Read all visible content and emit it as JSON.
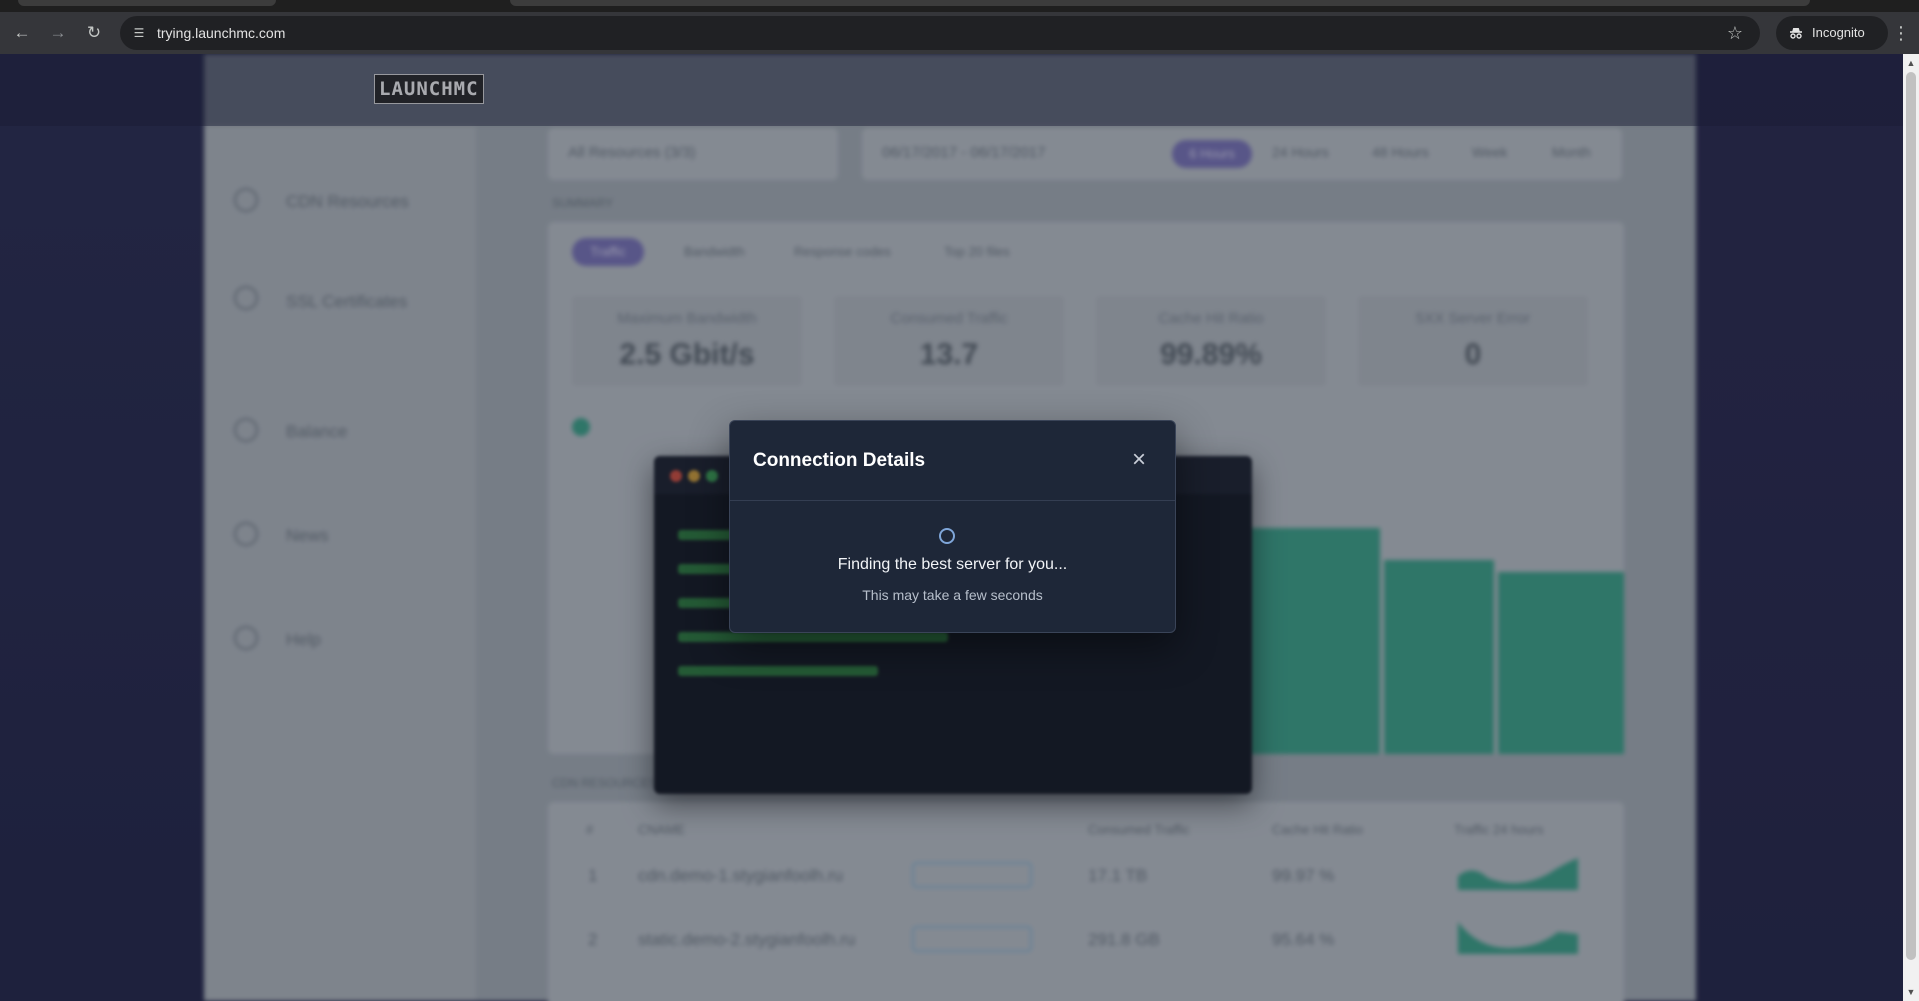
{
  "browser": {
    "url": "trying.launchmc.com",
    "incognito_label": "Incognito",
    "icons": [
      "back-icon",
      "forward-icon",
      "reload-icon",
      "site-info-icon",
      "bookmark-star-icon",
      "incognito-icon",
      "more-vert-icon"
    ]
  },
  "site": {
    "logo": "LAUNCHMC"
  },
  "background_dashboard": {
    "sidebar_items": [
      "CDN Resources",
      "SSL Certificates",
      "Balance",
      "News",
      "Help"
    ],
    "filters": {
      "resource_select": "All Resources (3/3)",
      "date_range": "06/17/2017 - 06/17/2017",
      "ranges": [
        "6 Hours",
        "24 Hours",
        "48 Hours",
        "Week",
        "Month"
      ]
    },
    "section_label": "SUMMARY",
    "tabs": [
      "Traffic",
      "Bandwidth",
      "Response codes",
      "Top 20 files"
    ],
    "stats": [
      {
        "title": "Maximum Bandwidth",
        "value": "2.5 Gbit/s"
      },
      {
        "title": "Consumed Traffic",
        "value": "13.7"
      },
      {
        "title": "Cache Hit Ratio",
        "value": "99.89%"
      },
      {
        "title": "5XX Server Error",
        "value": "0"
      }
    ],
    "table_label": "CDN RESOURCES",
    "table_headers": [
      "#",
      "CNAME",
      "Consumed Traffic",
      "Cache Hit Ratio",
      "Traffic 24 hours"
    ],
    "rows": [
      {
        "n": "1",
        "cname": "cdn.demo-1.stygianfoolh.ru",
        "traffic": "17.1 TB",
        "ratio": "99.97 %"
      },
      {
        "n": "2",
        "cname": "static.demo-2.stygianfoolh.ru",
        "traffic": "291.8 GB",
        "ratio": "95.64 %"
      }
    ]
  },
  "modal": {
    "title": "Connection Details",
    "message": "Finding the best server for you...",
    "submessage": "This may take a few seconds"
  },
  "colors": {
    "modal_bg": "#1e2738",
    "accent_spinner": "#7fa6d9",
    "chart_green": "#3ea58a"
  }
}
